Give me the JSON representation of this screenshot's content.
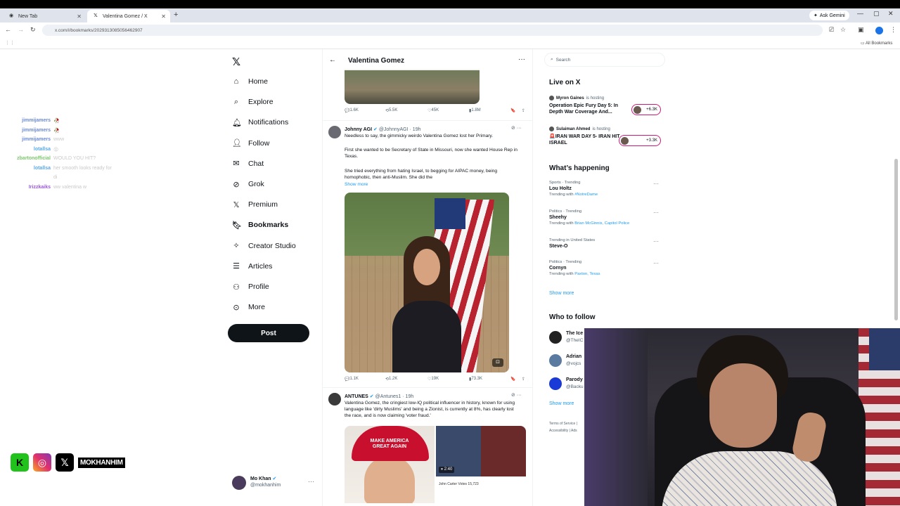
{
  "browser": {
    "tabs": [
      {
        "label": "New Tab",
        "active": false
      },
      {
        "label": "Valentina Gomez / X",
        "active": true
      }
    ],
    "ask_gemini": "Ask Gemini",
    "url": "x.com/i/bookmarks/2029313085056462907",
    "all_bookmarks": "All Bookmarks"
  },
  "sidebar": {
    "items": [
      {
        "label": "Home",
        "icon": "home-icon"
      },
      {
        "label": "Explore",
        "icon": "search-icon"
      },
      {
        "label": "Notifications",
        "icon": "bell-icon"
      },
      {
        "label": "Follow",
        "icon": "follow-icon"
      },
      {
        "label": "Chat",
        "icon": "mail-icon"
      },
      {
        "label": "Grok",
        "icon": "grok-icon"
      },
      {
        "label": "Premium",
        "icon": "x-premium-icon"
      },
      {
        "label": "Bookmarks",
        "icon": "bookmark-icon"
      },
      {
        "label": "Creator Studio",
        "icon": "creator-studio-icon"
      },
      {
        "label": "Articles",
        "icon": "articles-icon"
      },
      {
        "label": "Profile",
        "icon": "person-icon"
      },
      {
        "label": "More",
        "icon": "more-circle-icon"
      }
    ],
    "post_label": "Post",
    "account": {
      "name": "Mo Khan",
      "handle": "@mokhanhim"
    }
  },
  "stream_chat": [
    {
      "user": "jimmijamers",
      "msg": "🥀",
      "color": "#6a8ad8"
    },
    {
      "user": "jimmijamers",
      "msg": "🥀",
      "color": "#6a8ad8"
    },
    {
      "user": "jimmijamers",
      "msg": "www",
      "color": "#6a8ad8"
    },
    {
      "user": "lotallsa",
      "msg": "😮",
      "color": "#5aa8e8"
    },
    {
      "user": "zbartonofficial",
      "msg": "WOULD YOU HIT?",
      "color": "#7ac86a"
    },
    {
      "user": "lotallsa",
      "msg": "her smooth looks ready for",
      "color": "#5aa8e8"
    },
    {
      "user": "",
      "msg": "di",
      "color": "#5aa8e8"
    },
    {
      "user": "Irizzkaiks",
      "msg": "ww valentina w",
      "color": "#9a5ad8"
    }
  ],
  "socials": {
    "handle": "MOKHANHIM"
  },
  "main": {
    "header_title": "Valentina Gomez",
    "top_post_stats": {
      "replies": "1.6K",
      "reposts": "5.5K",
      "likes": "45K",
      "views": "1.8M"
    },
    "tweets": [
      {
        "name": "Johnny AGI",
        "handle": "@JohnnyAGI",
        "time": "19h",
        "text": [
          "Needless to say, the gimmicky weirdo Valentina Gomez lost her Primary.",
          "First she wanted to be Secretary of State in Missouri, now she wanted House Rep in Texas.",
          "She tried everything from hating Israel, to begging for AIPAC money, being homophobic, then anti-Muslim. She did the"
        ],
        "show_more": "Show more",
        "stats": {
          "replies": "1.1K",
          "reposts": "1.2K",
          "likes": "19K",
          "views": "73.3K"
        }
      },
      {
        "name": "ANTUNES",
        "handle": "@Antunes1",
        "time": "19h",
        "text": [
          "Valentina Gomez, the cringiest low-IQ political influencer in history, known for using language like 'dirty Muslims' and being a Zionist, is currently at 8%, has clearly lost the race, and is now claiming 'voter fraud.'"
        ],
        "media_cap_text": "MAKE AMERICA GREAT AGAIN",
        "video_duration": "2:40",
        "video_caption": "John Carter   Votes   15,723"
      }
    ]
  },
  "right": {
    "search_placeholder": "Search",
    "live_title": "Live on X",
    "live": [
      {
        "host": "Myron Gaines",
        "status": "is hosting",
        "title": "Operation Epic Fury Day 5: In Depth War Coverage And...",
        "count": "+6.3K"
      },
      {
        "host": "Sulaiman Ahmed",
        "status": "is hosting",
        "title": "🚨IRAN WAR DAY 5- IRAN HIT ISRAEL",
        "count": "+3.3K"
      }
    ],
    "happening_title": "What’s happening",
    "trends": [
      {
        "context": "Sports · Trending",
        "name": "Lou Holtz",
        "with": "#NotreDame"
      },
      {
        "context": "Politics · Trending",
        "name": "Sheehy",
        "with": "Brian McGinnis, Capitol Police"
      },
      {
        "context": "Trending in United States",
        "name": "Steve-O",
        "with": ""
      },
      {
        "context": "Politics · Trending",
        "name": "Cornyn",
        "with": "Paxton, Texas"
      }
    ],
    "show_more": "Show more",
    "who_title": "Who to follow",
    "who": [
      {
        "name": "The Ice",
        "handle": "@TheIC"
      },
      {
        "name": "Adrian",
        "handle": "@vojcs"
      },
      {
        "name": "Parody",
        "handle": "@Backu"
      }
    ],
    "who_show_more": "Show more",
    "footer": [
      "Terms of Service  |",
      "Accessibility  |  Ads"
    ]
  }
}
